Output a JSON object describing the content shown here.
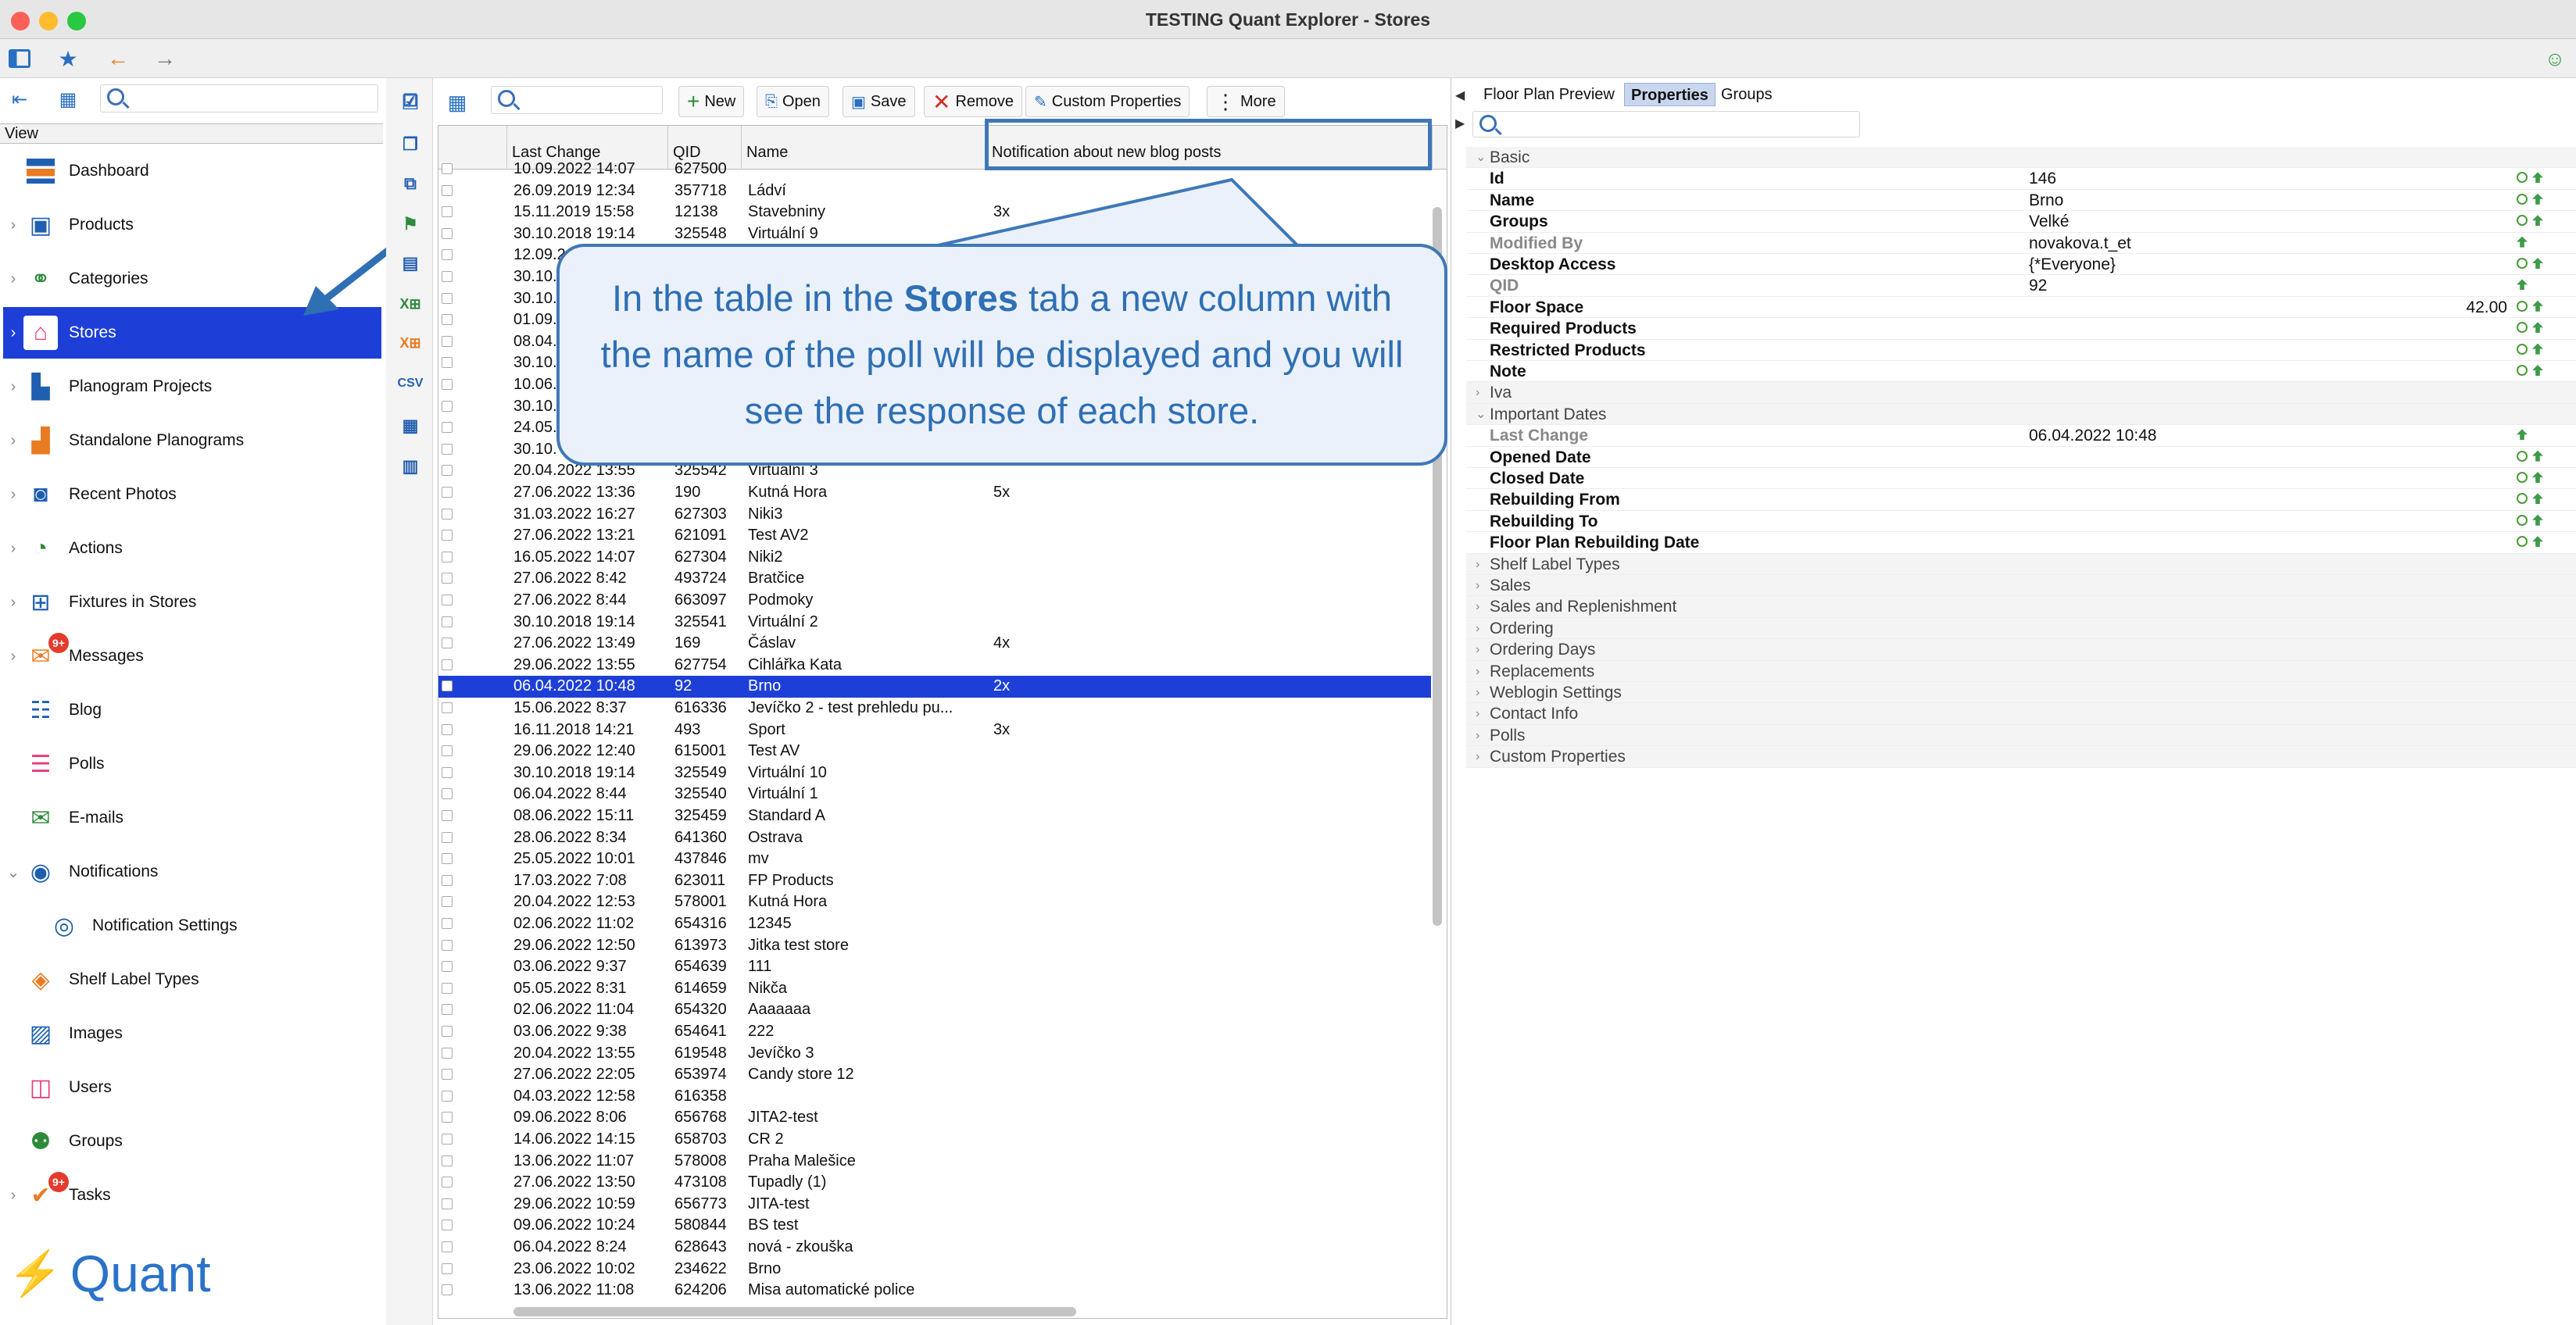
{
  "window": {
    "title": "TESTING Quant Explorer - Stores"
  },
  "colors": {
    "accent": "#1d3fd8",
    "callout": "#3f78b8",
    "badge": "#e53b2c"
  },
  "sidebar": {
    "view_label": "View",
    "items": [
      {
        "label": "Dashboard",
        "icon": "dashboard-icon"
      },
      {
        "label": "Products",
        "icon": "products-icon"
      },
      {
        "label": "Categories",
        "icon": "categories-icon"
      },
      {
        "label": "Stores",
        "icon": "stores-icon",
        "selected": true
      },
      {
        "label": "Planogram Projects",
        "icon": "planogram-projects-icon"
      },
      {
        "label": "Standalone Planograms",
        "icon": "standalone-planograms-icon"
      },
      {
        "label": "Recent Photos",
        "icon": "camera-icon"
      },
      {
        "label": "Actions",
        "icon": "actions-icon"
      },
      {
        "label": "Fixtures in Stores",
        "icon": "fixtures-icon"
      },
      {
        "label": "Messages",
        "icon": "messages-icon",
        "badge": "9+"
      },
      {
        "label": "Blog",
        "icon": "blog-icon"
      },
      {
        "label": "Polls",
        "icon": "polls-icon"
      },
      {
        "label": "E-mails",
        "icon": "email-icon"
      },
      {
        "label": "Notifications",
        "icon": "notifications-icon"
      },
      {
        "label": "Notification Settings",
        "icon": "notification-settings-icon"
      },
      {
        "label": "Shelf Label Types",
        "icon": "shelf-label-icon"
      },
      {
        "label": "Images",
        "icon": "images-icon"
      },
      {
        "label": "Users",
        "icon": "users-icon"
      },
      {
        "label": "Groups",
        "icon": "groups-icon"
      },
      {
        "label": "Tasks",
        "icon": "tasks-icon",
        "badge": "9+"
      }
    ],
    "logo_text": "Quant"
  },
  "toolbar": {
    "new": "New",
    "open": "Open",
    "save": "Save",
    "remove": "Remove",
    "custom": "Custom Properties",
    "more": "More"
  },
  "table": {
    "headers": [
      "Last Change",
      "QID",
      "Name",
      "Notification about new blog posts"
    ],
    "rows": [
      [
        "10.09.2022 14:07",
        "627500",
        "",
        ""
      ],
      [
        "26.09.2019 12:34",
        "357718",
        "Ládví",
        ""
      ],
      [
        "15.11.2019 15:58",
        "12138",
        "Stavebniny",
        "3x"
      ],
      [
        "30.10.2018 19:14",
        "325548",
        "Virtuální 9",
        ""
      ],
      [
        "12.09.2",
        "",
        "",
        ""
      ],
      [
        "30.10.",
        "",
        "",
        ""
      ],
      [
        "30.10.",
        "",
        "",
        ""
      ],
      [
        "01.09.",
        "",
        "",
        ""
      ],
      [
        "08.04.",
        "",
        "",
        ""
      ],
      [
        "30.10.",
        "",
        "",
        ""
      ],
      [
        "10.06.",
        "",
        "",
        ""
      ],
      [
        "30.10.",
        "",
        "",
        ""
      ],
      [
        "24.05.",
        "",
        "",
        ""
      ],
      [
        "30.10.",
        "",
        "",
        ""
      ],
      [
        "20.04.2022 13:55",
        "325542",
        "Virtuální 3",
        ""
      ],
      [
        "27.06.2022 13:36",
        "190",
        "Kutná Hora",
        "5x"
      ],
      [
        "31.03.2022 16:27",
        "627303",
        "Niki3",
        ""
      ],
      [
        "27.06.2022 13:21",
        "621091",
        "Test AV2",
        ""
      ],
      [
        "16.05.2022 14:07",
        "627304",
        "Niki2",
        ""
      ],
      [
        "27.06.2022 8:42",
        "493724",
        "Bratčice",
        ""
      ],
      [
        "27.06.2022 8:44",
        "663097",
        "Podmoky",
        ""
      ],
      [
        "30.10.2018 19:14",
        "325541",
        "Virtuální 2",
        ""
      ],
      [
        "27.06.2022 13:49",
        "169",
        "Čáslav",
        "4x"
      ],
      [
        "29.06.2022 13:55",
        "627754",
        "Cihlářka Kata",
        ""
      ],
      [
        "06.04.2022 10:48",
        "92",
        "Brno",
        "2x"
      ],
      [
        "15.06.2022 8:37",
        "616336",
        "Jevíčko 2 - test prehledu pu...",
        ""
      ],
      [
        "16.11.2018 14:21",
        "493",
        "Sport",
        "3x"
      ],
      [
        "29.06.2022 12:40",
        "615001",
        "Test AV",
        ""
      ],
      [
        "30.10.2018 19:14",
        "325549",
        "Virtuální 10",
        ""
      ],
      [
        "06.04.2022 8:44",
        "325540",
        "Virtuální 1",
        ""
      ],
      [
        "08.06.2022 15:11",
        "325459",
        "Standard A",
        ""
      ],
      [
        "28.06.2022 8:34",
        "641360",
        "Ostrava",
        ""
      ],
      [
        "25.05.2022 10:01",
        "437846",
        "mv",
        ""
      ],
      [
        "17.03.2022 7:08",
        "623011",
        "FP Products",
        ""
      ],
      [
        "20.04.2022 12:53",
        "578001",
        "Kutná Hora",
        ""
      ],
      [
        "02.06.2022 11:02",
        "654316",
        "12345",
        ""
      ],
      [
        "29.06.2022 12:50",
        "613973",
        "Jitka test store",
        ""
      ],
      [
        "03.06.2022 9:37",
        "654639",
        "111",
        ""
      ],
      [
        "05.05.2022 8:31",
        "614659",
        "Nikča",
        ""
      ],
      [
        "02.06.2022 11:04",
        "654320",
        "Aaaaaaa",
        ""
      ],
      [
        "03.06.2022 9:38",
        "654641",
        "222",
        ""
      ],
      [
        "20.04.2022 13:55",
        "619548",
        "Jevíčko 3",
        ""
      ],
      [
        "27.06.2022 22:05",
        "653974",
        "Candy store 12",
        ""
      ],
      [
        "04.03.2022 12:58",
        "616358",
        "",
        ""
      ],
      [
        "09.06.2022 8:06",
        "656768",
        "JITA2-test",
        ""
      ],
      [
        "14.06.2022 14:15",
        "658703",
        "CR 2",
        ""
      ],
      [
        "13.06.2022 11:07",
        "578008",
        "Praha Malešice",
        ""
      ],
      [
        "27.06.2022 13:50",
        "473108",
        "Tupadly (1)",
        ""
      ],
      [
        "29.06.2022 10:59",
        "656773",
        "JITA-test",
        ""
      ],
      [
        "09.06.2022 10:24",
        "580844",
        "BS test",
        ""
      ],
      [
        "06.04.2022 8:24",
        "628643",
        "nová - zkouška",
        ""
      ],
      [
        "23.06.2022 10:02",
        "234622",
        "Brno",
        ""
      ],
      [
        "13.06.2022 11:08",
        "624206",
        "Misa automatické police",
        ""
      ]
    ],
    "selected_index": 24
  },
  "callout": {
    "pre": "In the table in the ",
    "bold": "Stores",
    "post": " tab a new column with the name of the poll will be displayed and you will see the response of each store."
  },
  "right": {
    "tabs": [
      "Floor Plan Preview",
      "Properties",
      "Groups"
    ],
    "rows": [
      {
        "t": "group",
        "label": "Basic",
        "open": true
      },
      {
        "t": "bold",
        "label": "Id",
        "value": "146"
      },
      {
        "t": "bold",
        "label": "Name",
        "value": "Brno"
      },
      {
        "t": "bold",
        "label": "Groups",
        "value": "Velké"
      },
      {
        "t": "grey",
        "label": "Modified By",
        "value": "novakova.t_et"
      },
      {
        "t": "bold",
        "label": "Desktop Access",
        "value": "{*Everyone}"
      },
      {
        "t": "grey",
        "label": "QID",
        "value": "92"
      },
      {
        "t": "bold",
        "label": "Floor Space",
        "valuer": "42.00"
      },
      {
        "t": "bold",
        "label": "Required Products",
        "value": ""
      },
      {
        "t": "bold",
        "label": "Restricted Products",
        "value": ""
      },
      {
        "t": "bold",
        "label": "Note",
        "value": ""
      },
      {
        "t": "group",
        "label": "Iva",
        "open": false
      },
      {
        "t": "group",
        "label": "Important Dates",
        "open": true
      },
      {
        "t": "grey",
        "label": "Last Change",
        "value": "06.04.2022 10:48"
      },
      {
        "t": "bold",
        "label": "Opened Date",
        "value": ""
      },
      {
        "t": "bold",
        "label": "Closed Date",
        "value": ""
      },
      {
        "t": "bold",
        "label": "Rebuilding From",
        "value": ""
      },
      {
        "t": "bold",
        "label": "Rebuilding To",
        "value": ""
      },
      {
        "t": "bold",
        "label": "Floor Plan Rebuilding Date",
        "value": ""
      },
      {
        "t": "group",
        "label": "Shelf Label Types",
        "open": false
      },
      {
        "t": "group",
        "label": "Sales",
        "open": false
      },
      {
        "t": "group",
        "label": "Sales and Replenishment",
        "open": false
      },
      {
        "t": "group",
        "label": "Ordering",
        "open": false
      },
      {
        "t": "group",
        "label": "Ordering Days",
        "open": false
      },
      {
        "t": "group",
        "label": "Replacements",
        "open": false
      },
      {
        "t": "group",
        "label": "Weblogin Settings",
        "open": false
      },
      {
        "t": "group",
        "label": "Contact Info",
        "open": false
      },
      {
        "t": "group",
        "label": "Polls",
        "open": false
      },
      {
        "t": "group",
        "label": "Custom Properties",
        "open": false
      }
    ]
  }
}
